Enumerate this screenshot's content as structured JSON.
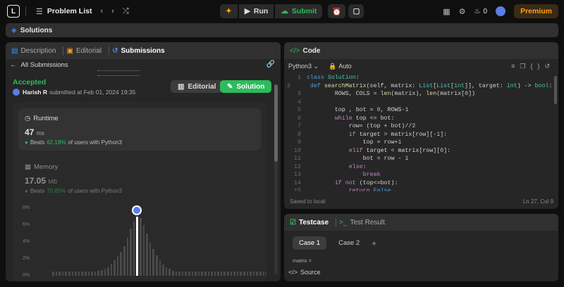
{
  "topbar": {
    "logo": "L",
    "title": "Problem List",
    "run": "Run",
    "submit": "Submit",
    "premium": "Premium",
    "streak": "0"
  },
  "solutions_tab": "Solutions",
  "left": {
    "tabs": [
      "Description",
      "Editorial",
      "Submissions"
    ],
    "back": "All Submissions",
    "status": "Accepted",
    "user": "Harish R",
    "submitted": "submitted at Feb 01, 2024 19:35",
    "editorial_btn": "Editorial",
    "solution_btn": "Solution",
    "runtime": {
      "label": "Runtime",
      "value": "47",
      "unit": "ms",
      "beats": "Beats",
      "pct": "62.18%",
      "suffix": "of users with Python3"
    },
    "memory": {
      "label": "Memory",
      "value": "17.05",
      "unit": "MB",
      "beats": "Beats",
      "pct": "70.85%",
      "suffix": "of users with Python3"
    },
    "yticks": [
      "8%",
      "6%",
      "4%",
      "2%",
      "0%"
    ]
  },
  "chart_data": {
    "type": "bar",
    "ylim": [
      0,
      8
    ],
    "yticks": [
      "8%",
      "6%",
      "4%",
      "2%",
      "0%"
    ],
    "values": [
      0.5,
      0.5,
      0.5,
      0.5,
      0.5,
      0.5,
      0.5,
      0.5,
      0.5,
      0.5,
      0.5,
      0.5,
      0.5,
      0.5,
      0.6,
      0.7,
      0.8,
      1.0,
      1.4,
      1.8,
      2.3,
      2.8,
      3.5,
      4.5,
      5.6,
      6.5,
      7.0,
      6.8,
      6.0,
      5.0,
      4.0,
      3.2,
      2.4,
      1.8,
      1.3,
      1.0,
      0.8,
      0.6,
      0.5,
      0.5,
      0.5,
      0.5,
      0.5,
      0.5,
      0.5,
      0.5,
      0.5,
      0.5,
      0.5,
      0.5,
      0.5,
      0.5,
      0.5,
      0.5,
      0.5,
      0.5,
      0.5,
      0.5,
      0.5,
      0.5,
      0.5,
      0.5,
      0.5,
      0.5,
      0.5,
      0.5,
      0.5,
      0.5,
      0.5,
      0.5,
      0.5,
      0.5,
      0.5,
      0.5,
      0.5,
      0.5
    ],
    "highlight": 26
  },
  "code": {
    "title": "Code",
    "language": "Python3",
    "auto": "Auto",
    "saved": "Saved to local",
    "cursor": "Ln 27, Col 9"
  },
  "testcase": {
    "tab1": "Testcase",
    "tab2": "Test Result",
    "cases": [
      "Case 1",
      "Case 2"
    ],
    "add": "+",
    "param": "matrix =",
    "source": "Source"
  }
}
